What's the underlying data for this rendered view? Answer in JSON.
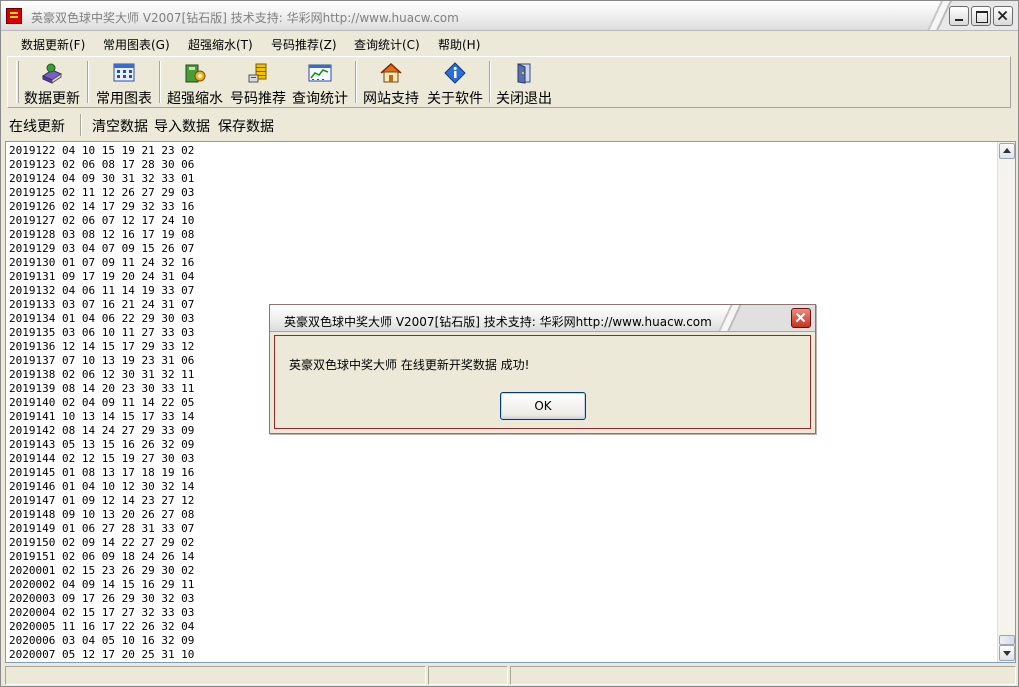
{
  "window": {
    "title": "英豪双色球中奖大师  V2007[钻石版]  技术支持: 华彩网http://www.huacw.com"
  },
  "menu": [
    {
      "label": "数据更新(F)"
    },
    {
      "label": "常用图表(G)"
    },
    {
      "label": "超强缩水(T)"
    },
    {
      "label": "号码推荐(Z)"
    },
    {
      "label": "查询统计(C)"
    },
    {
      "label": "帮助(H)"
    }
  ],
  "toolbar": [
    {
      "label": "数据更新",
      "icon": "book-icon"
    },
    {
      "label": "常用图表",
      "icon": "grid-chart-icon"
    },
    {
      "label": "超强缩水",
      "icon": "gear-book-icon"
    },
    {
      "label": "号码推荐",
      "icon": "coins-icon"
    },
    {
      "label": "查询统计",
      "icon": "statistics-icon"
    },
    {
      "label": "网站支持",
      "icon": "home-icon"
    },
    {
      "label": "关于软件",
      "icon": "info-icon"
    },
    {
      "label": "关闭退出",
      "icon": "exit-door-icon"
    }
  ],
  "actions": {
    "online_update": "在线更新",
    "clear": "清空数据",
    "import": "导入数据",
    "save": "保存数据"
  },
  "draws": [
    "2019122 04 10 15 19 21 23 02",
    "2019123 02 06 08 17 28 30 06",
    "2019124 04 09 30 31 32 33 01",
    "2019125 02 11 12 26 27 29 03",
    "2019126 02 14 17 29 32 33 16",
    "2019127 02 06 07 12 17 24 10",
    "2019128 03 08 12 16 17 19 08",
    "2019129 03 04 07 09 15 26 07",
    "2019130 01 07 09 11 24 32 16",
    "2019131 09 17 19 20 24 31 04",
    "2019132 04 06 11 14 19 33 07",
    "2019133 03 07 16 21 24 31 07",
    "2019134 01 04 06 22 29 30 03",
    "2019135 03 06 10 11 27 33 03",
    "2019136 12 14 15 17 29 33 12",
    "2019137 07 10 13 19 23 31 06",
    "2019138 02 06 12 30 31 32 11",
    "2019139 08 14 20 23 30 33 11",
    "2019140 02 04 09 11 14 22 05",
    "2019141 10 13 14 15 17 33 14",
    "2019142 08 14 24 27 29 33 09",
    "2019143 05 13 15 16 26 32 09",
    "2019144 02 12 15 19 27 30 03",
    "2019145 01 08 13 17 18 19 16",
    "2019146 01 04 10 12 30 32 14",
    "2019147 01 09 12 14 23 27 12",
    "2019148 09 10 13 20 26 27 08",
    "2019149 01 06 27 28 31 33 07",
    "2019150 02 09 14 22 27 29 02",
    "2019151 02 06 09 18 24 26 14",
    "2020001 02 15 23 26 29 30 02",
    "2020002 04 09 14 15 16 29 11",
    "2020003 09 17 26 29 30 32 03",
    "2020004 02 15 17 27 32 33 03",
    "2020005 11 16 17 22 26 32 04",
    "2020006 03 04 05 10 16 32 09",
    "2020007 05 12 17 20 25 31 10"
  ],
  "dialog": {
    "title": "英豪双色球中奖大师  V2007[钻石版]  技术支持: 华彩网http://www.huacw.com",
    "message": "英豪双色球中奖大师 在线更新开奖数据 成功!",
    "ok_label": "OK"
  }
}
